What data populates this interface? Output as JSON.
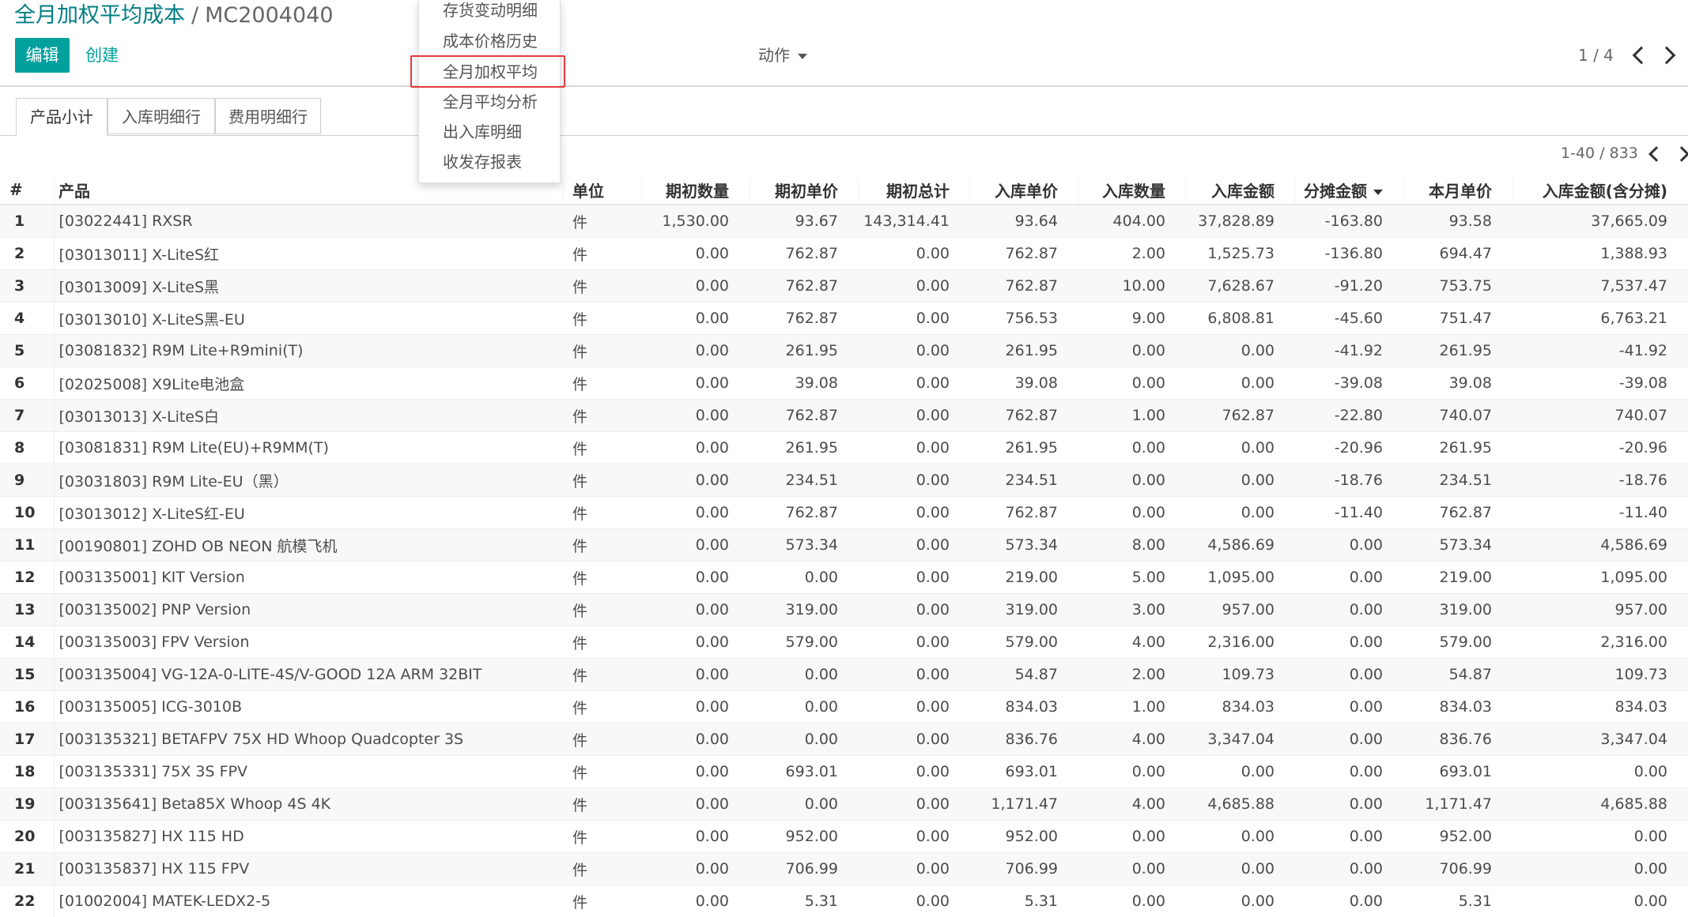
{
  "breadcrumb": {
    "parent": "全月加权平均成本",
    "separator": "/",
    "current": "MC2004040"
  },
  "buttons": {
    "edit": "编辑",
    "create": "创建"
  },
  "action_menu": {
    "label": "动作",
    "items": [
      "存货变动明细",
      "成本价格历史",
      "全月加权平均",
      "全月平均分析",
      "出入库明细",
      "收发存报表"
    ],
    "highlighted_index": 2
  },
  "record_pager": "1 / 4",
  "tabs": [
    "产品小计",
    "入库明细行",
    "费用明细行"
  ],
  "active_tab": 0,
  "list_pager": "1-40 / 833",
  "columns": [
    "#",
    "产品",
    "单位",
    "期初数量",
    "期初单价",
    "期初总计",
    "入库单价",
    "入库数量",
    "入库金额",
    "分摊金额",
    "本月单价",
    "入库金额(含分摊)"
  ],
  "rows": [
    [
      "1",
      "[03022441] RXSR",
      "件",
      "1,530.00",
      "93.67",
      "143,314.41",
      "93.64",
      "404.00",
      "37,828.89",
      "-163.80",
      "93.58",
      "37,665.09"
    ],
    [
      "2",
      "[03013011] X-LiteS红",
      "件",
      "0.00",
      "762.87",
      "0.00",
      "762.87",
      "2.00",
      "1,525.73",
      "-136.80",
      "694.47",
      "1,388.93"
    ],
    [
      "3",
      "[03013009] X-LiteS黑",
      "件",
      "0.00",
      "762.87",
      "0.00",
      "762.87",
      "10.00",
      "7,628.67",
      "-91.20",
      "753.75",
      "7,537.47"
    ],
    [
      "4",
      "[03013010] X-LiteS黑-EU",
      "件",
      "0.00",
      "762.87",
      "0.00",
      "756.53",
      "9.00",
      "6,808.81",
      "-45.60",
      "751.47",
      "6,763.21"
    ],
    [
      "5",
      "[03081832] R9M Lite+R9mini(T)",
      "件",
      "0.00",
      "261.95",
      "0.00",
      "261.95",
      "0.00",
      "0.00",
      "-41.92",
      "261.95",
      "-41.92"
    ],
    [
      "6",
      "[02025008] X9Lite电池盒",
      "件",
      "0.00",
      "39.08",
      "0.00",
      "39.08",
      "0.00",
      "0.00",
      "-39.08",
      "39.08",
      "-39.08"
    ],
    [
      "7",
      "[03013013] X-LiteS白",
      "件",
      "0.00",
      "762.87",
      "0.00",
      "762.87",
      "1.00",
      "762.87",
      "-22.80",
      "740.07",
      "740.07"
    ],
    [
      "8",
      "[03081831] R9M Lite(EU)+R9MM(T)",
      "件",
      "0.00",
      "261.95",
      "0.00",
      "261.95",
      "0.00",
      "0.00",
      "-20.96",
      "261.95",
      "-20.96"
    ],
    [
      "9",
      "[03031803] R9M Lite-EU（黑）",
      "件",
      "0.00",
      "234.51",
      "0.00",
      "234.51",
      "0.00",
      "0.00",
      "-18.76",
      "234.51",
      "-18.76"
    ],
    [
      "10",
      "[03013012] X-LiteS红-EU",
      "件",
      "0.00",
      "762.87",
      "0.00",
      "762.87",
      "0.00",
      "0.00",
      "-11.40",
      "762.87",
      "-11.40"
    ],
    [
      "11",
      "[00190801] ZOHD OB NEON 航模飞机",
      "件",
      "0.00",
      "573.34",
      "0.00",
      "573.34",
      "8.00",
      "4,586.69",
      "0.00",
      "573.34",
      "4,586.69"
    ],
    [
      "12",
      "[003135001] KIT Version",
      "件",
      "0.00",
      "0.00",
      "0.00",
      "219.00",
      "5.00",
      "1,095.00",
      "0.00",
      "219.00",
      "1,095.00"
    ],
    [
      "13",
      "[003135002] PNP Version",
      "件",
      "0.00",
      "319.00",
      "0.00",
      "319.00",
      "3.00",
      "957.00",
      "0.00",
      "319.00",
      "957.00"
    ],
    [
      "14",
      "[003135003] FPV Version",
      "件",
      "0.00",
      "579.00",
      "0.00",
      "579.00",
      "4.00",
      "2,316.00",
      "0.00",
      "579.00",
      "2,316.00"
    ],
    [
      "15",
      "[003135004] VG-12A-0-LITE-4S/V-GOOD 12A ARM 32BIT",
      "件",
      "0.00",
      "0.00",
      "0.00",
      "54.87",
      "2.00",
      "109.73",
      "0.00",
      "54.87",
      "109.73"
    ],
    [
      "16",
      "[003135005] ICG-3010B",
      "件",
      "0.00",
      "0.00",
      "0.00",
      "834.03",
      "1.00",
      "834.03",
      "0.00",
      "834.03",
      "834.03"
    ],
    [
      "17",
      "[003135321] BETAFPV 75X HD Whoop Quadcopter 3S",
      "件",
      "0.00",
      "0.00",
      "0.00",
      "836.76",
      "4.00",
      "3,347.04",
      "0.00",
      "836.76",
      "3,347.04"
    ],
    [
      "18",
      "[003135331] 75X 3S FPV",
      "件",
      "0.00",
      "693.01",
      "0.00",
      "693.01",
      "0.00",
      "0.00",
      "0.00",
      "693.01",
      "0.00"
    ],
    [
      "19",
      "[003135641] Beta85X Whoop 4S 4K",
      "件",
      "0.00",
      "0.00",
      "0.00",
      "1,171.47",
      "4.00",
      "4,685.88",
      "0.00",
      "1,171.47",
      "4,685.88"
    ],
    [
      "20",
      "[003135827] HX 115 HD",
      "件",
      "0.00",
      "952.00",
      "0.00",
      "952.00",
      "0.00",
      "0.00",
      "0.00",
      "952.00",
      "0.00"
    ],
    [
      "21",
      "[003135837] HX 115 FPV",
      "件",
      "0.00",
      "706.99",
      "0.00",
      "706.99",
      "0.00",
      "0.00",
      "0.00",
      "706.99",
      "0.00"
    ],
    [
      "22",
      "[01002004] MATEK-LEDX2-5",
      "件",
      "0.00",
      "5.31",
      "0.00",
      "5.31",
      "0.00",
      "0.00",
      "0.00",
      "5.31",
      "0.00"
    ]
  ],
  "colors": {
    "accent": "#00a09d",
    "breadcrumb": "#017e84",
    "highlight_border": "#e4393c"
  },
  "icons": {
    "prev": "chevron-left-icon",
    "next": "chevron-right-icon",
    "caret": "caret-down-icon"
  }
}
